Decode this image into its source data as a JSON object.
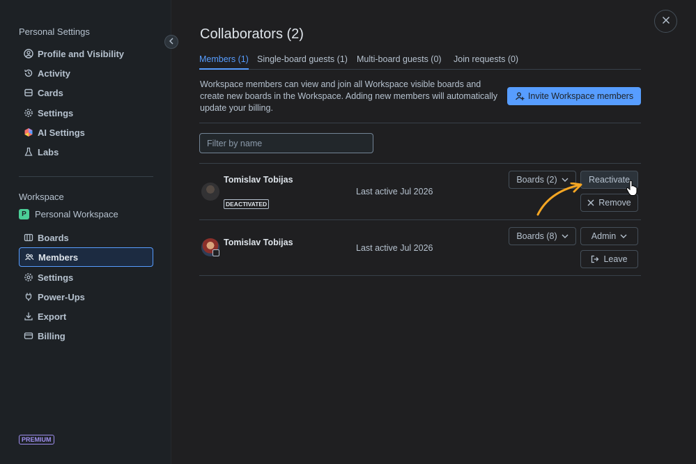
{
  "sidebar": {
    "personal_title": "Personal Settings",
    "personal_items": [
      {
        "label": "Profile and Visibility",
        "icon": "user-circle-icon"
      },
      {
        "label": "Activity",
        "icon": "history-icon"
      },
      {
        "label": "Cards",
        "icon": "cards-icon"
      },
      {
        "label": "Settings",
        "icon": "gear-icon"
      },
      {
        "label": "AI Settings",
        "icon": "ai-icon"
      },
      {
        "label": "Labs",
        "icon": "flask-icon"
      }
    ],
    "workspace_title": "Workspace",
    "workspace_badge": "P",
    "workspace_name": "Personal Workspace",
    "workspace_items": [
      {
        "label": "Boards",
        "icon": "boards-icon"
      },
      {
        "label": "Members",
        "icon": "members-icon",
        "active": true
      },
      {
        "label": "Settings",
        "icon": "gear-icon"
      },
      {
        "label": "Power-Ups",
        "icon": "plug-icon"
      },
      {
        "label": "Export",
        "icon": "download-icon"
      },
      {
        "label": "Billing",
        "icon": "card-icon"
      }
    ],
    "premium": "PREMIUM"
  },
  "main": {
    "title": "Collaborators (2)",
    "tabs": [
      {
        "label": "Members (1)",
        "active": true
      },
      {
        "label": "Single-board guests (1)"
      },
      {
        "label": "Multi-board guests (0)"
      },
      {
        "label": "Join requests (0)"
      }
    ],
    "description": "Workspace members can view and join all Workspace visible boards and create new boards in the Workspace. Adding new members will automatically update your billing.",
    "invite_label": "Invite Workspace members",
    "filter_placeholder": "Filter by name",
    "members": [
      {
        "name": "Tomislav Tobijas",
        "status": "DEACTIVATED",
        "last_active": "Last active Jul 2026",
        "boards_label": "Boards (2)",
        "primary_action": "Reactivate",
        "secondary_action": "Remove"
      },
      {
        "name": "Tomislav Tobijas",
        "last_active": "Last active Jul 2026",
        "boards_label": "Boards (8)",
        "primary_action": "Admin",
        "secondary_action": "Leave"
      }
    ]
  },
  "colors": {
    "accent": "#579dff",
    "annotation_arrow": "#f5a623",
    "premium": "#9f8fef"
  }
}
